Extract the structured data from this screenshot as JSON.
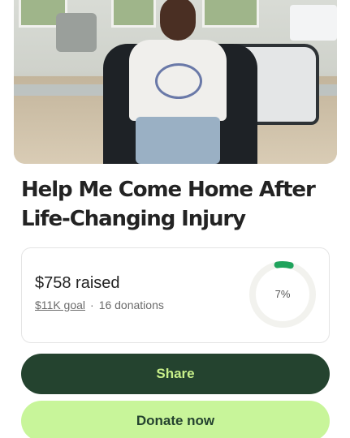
{
  "campaign": {
    "title_line1": "Help Me Come Home After",
    "title_line2": "Life-Changing Injury"
  },
  "progress": {
    "raised_text": "$758 raised",
    "goal_text": "$11K goal",
    "separator": "·",
    "donations_text": "16 donations",
    "percent_text": "7%",
    "percent_value": 0.07,
    "ring_color": "#1fa35c",
    "track_color": "#f2f2ee"
  },
  "actions": {
    "share_label": "Share",
    "donate_label": "Donate now"
  },
  "colors": {
    "primary_dark": "#24432f",
    "accent_lime": "#c8f59a",
    "share_text": "#c8f08a"
  }
}
